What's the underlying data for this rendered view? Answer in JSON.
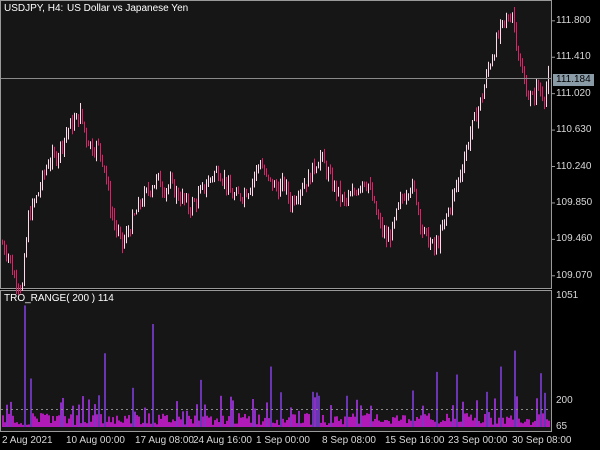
{
  "header": {
    "symbol": "USDJPY, H4:",
    "description": "US Dollar vs Japanese Yen"
  },
  "indicator": {
    "label": "TRO_RANGE( 200 ) 114",
    "scale_max": "1051",
    "level": "200",
    "scale_min": "65"
  },
  "current_price": "111.184",
  "price_axis": [
    "111.800",
    "111.410",
    "111.020",
    "110.630",
    "110.240",
    "109.850",
    "109.460",
    "109.070"
  ],
  "time_axis": [
    "2 Aug 2021",
    "10 Aug 00:00",
    "17 Aug 08:00",
    "24 Aug 16:00",
    "1 Sep 00:00",
    "8 Sep 08:00",
    "15 Sep 16:00",
    "23 Sep 00:00",
    "30 Sep 08:00"
  ],
  "colors": {
    "background": "#000000",
    "panel_background": "#161616",
    "bull_candle": "#ffd8ec",
    "bear_candle": "#e0206a",
    "histogram_base": "#b01bb7",
    "histogram_mid": "#8b2fc0",
    "histogram_spike": "#6a35b2",
    "grid": "#777777"
  },
  "chart_data": {
    "type": "candlestick",
    "symbol": "USDJPY",
    "timeframe": "H4",
    "current_price": 111.184,
    "ylim": [
      108.95,
      111.98
    ],
    "yticks": [
      111.8,
      111.41,
      111.02,
      110.63,
      110.24,
      109.85,
      109.46,
      109.07
    ],
    "close_path": [
      [
        0,
        109.45
      ],
      [
        8,
        109.3
      ],
      [
        14,
        109.05
      ],
      [
        22,
        108.95
      ],
      [
        28,
        109.7
      ],
      [
        36,
        109.9
      ],
      [
        42,
        110.1
      ],
      [
        48,
        110.3
      ],
      [
        56,
        110.35
      ],
      [
        62,
        110.5
      ],
      [
        68,
        110.65
      ],
      [
        74,
        110.72
      ],
      [
        80,
        110.8
      ],
      [
        86,
        110.55
      ],
      [
        92,
        110.45
      ],
      [
        98,
        110.45
      ],
      [
        104,
        110.25
      ],
      [
        110,
        109.8
      ],
      [
        116,
        109.55
      ],
      [
        122,
        109.4
      ],
      [
        128,
        109.55
      ],
      [
        134,
        109.7
      ],
      [
        140,
        109.85
      ],
      [
        146,
        109.95
      ],
      [
        152,
        110.05
      ],
      [
        158,
        110.1
      ],
      [
        164,
        110.0
      ],
      [
        170,
        110.05
      ],
      [
        176,
        109.95
      ],
      [
        182,
        109.9
      ],
      [
        188,
        109.8
      ],
      [
        194,
        109.85
      ],
      [
        200,
        109.95
      ],
      [
        206,
        110.05
      ],
      [
        212,
        110.15
      ],
      [
        218,
        110.2
      ],
      [
        224,
        110.1
      ],
      [
        230,
        109.95
      ],
      [
        236,
        109.9
      ],
      [
        242,
        109.95
      ],
      [
        248,
        110.0
      ],
      [
        254,
        110.15
      ],
      [
        260,
        110.3
      ],
      [
        266,
        110.1
      ],
      [
        272,
        110.05
      ],
      [
        278,
        110.0
      ],
      [
        284,
        110.05
      ],
      [
        290,
        109.85
      ],
      [
        296,
        109.95
      ],
      [
        302,
        110.05
      ],
      [
        308,
        110.1
      ],
      [
        314,
        110.25
      ],
      [
        320,
        110.35
      ],
      [
        326,
        110.2
      ],
      [
        332,
        110.05
      ],
      [
        338,
        109.95
      ],
      [
        344,
        109.85
      ],
      [
        350,
        109.9
      ],
      [
        356,
        110.0
      ],
      [
        362,
        110.1
      ],
      [
        368,
        110.05
      ],
      [
        374,
        109.8
      ],
      [
        380,
        109.6
      ],
      [
        386,
        109.45
      ],
      [
        392,
        109.55
      ],
      [
        398,
        109.8
      ],
      [
        404,
        109.95
      ],
      [
        410,
        110.05
      ],
      [
        416,
        109.9
      ],
      [
        422,
        109.55
      ],
      [
        428,
        109.45
      ],
      [
        434,
        109.35
      ],
      [
        440,
        109.5
      ],
      [
        446,
        109.7
      ],
      [
        452,
        109.9
      ],
      [
        458,
        110.1
      ],
      [
        464,
        110.35
      ],
      [
        470,
        110.6
      ],
      [
        476,
        110.8
      ],
      [
        482,
        111.0
      ],
      [
        488,
        111.3
      ],
      [
        494,
        111.5
      ],
      [
        500,
        111.7
      ],
      [
        506,
        111.8
      ],
      [
        512,
        111.9
      ],
      [
        516,
        111.6
      ],
      [
        520,
        111.3
      ],
      [
        524,
        111.15
      ],
      [
        528,
        111.0
      ],
      [
        532,
        110.95
      ],
      [
        536,
        111.1
      ],
      [
        540,
        111.05
      ],
      [
        544,
        111.0
      ],
      [
        548,
        111.18
      ]
    ],
    "indicator": {
      "name": "TRO_RANGE",
      "period": 200,
      "value": 114,
      "ylim": [
        65,
        1051
      ],
      "level": 200
    }
  }
}
